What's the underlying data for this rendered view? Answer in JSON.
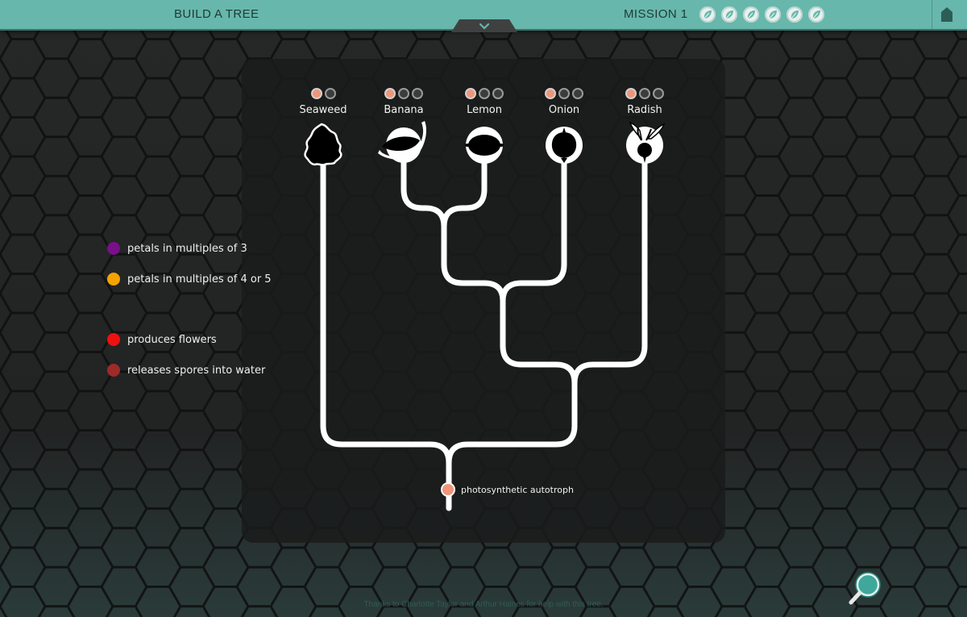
{
  "header": {
    "title": "BUILD A TREE",
    "mission_label": "MISSION 1",
    "mission_leaf_icons": [
      "leaf-icon",
      "leaf-icon",
      "leaf-icon",
      "leaf-icon",
      "leaf-icon",
      "leaf-icon"
    ],
    "home_icon": "home-icon",
    "collapse_icon": "chevron-down-icon"
  },
  "taxa": [
    {
      "label": "Seaweed",
      "icon": "seaweed-icon",
      "dots": [
        "filled",
        "empty"
      ]
    },
    {
      "label": "Banana",
      "icon": "banana-icon",
      "dots": [
        "filled",
        "empty",
        "empty"
      ]
    },
    {
      "label": "Lemon",
      "icon": "lemon-icon",
      "dots": [
        "filled",
        "empty",
        "empty"
      ]
    },
    {
      "label": "Onion",
      "icon": "onion-icon",
      "dots": [
        "filled",
        "empty",
        "empty"
      ]
    },
    {
      "label": "Radish",
      "icon": "radish-icon",
      "dots": [
        "filled",
        "empty",
        "empty"
      ]
    }
  ],
  "legend": [
    {
      "label": "petals in multiples of 3",
      "color": "#7a0f8a"
    },
    {
      "label": "petals in multiples of 4 or 5",
      "color": "#f5a300"
    },
    {
      "label": "produces flowers",
      "color": "#ee1111"
    },
    {
      "label": "releases spores into water",
      "color": "#9e2a2a"
    }
  ],
  "root_node": {
    "label": "photosynthetic autotroph",
    "color": "#ee957a"
  },
  "credits": "Thanks to Charlotte Taylor and Arthur Haines for help with this tree.",
  "colors": {
    "accent": "#67b7ac",
    "background": "#1c1d1d",
    "branch": "#ffffff",
    "filled_dot": "#ee957a",
    "empty_dot": "#3b3c3c"
  },
  "search_icon": "magnifier-icon"
}
